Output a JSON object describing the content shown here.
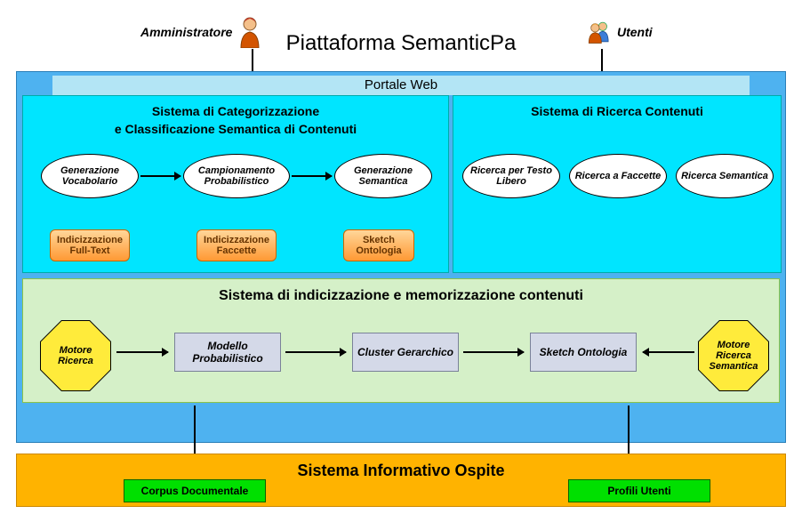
{
  "actors": {
    "admin": "Amministratore",
    "users": "Utenti"
  },
  "title": "Piattaforma SemanticPa",
  "portal": "Portale Web",
  "systemLeft": {
    "header1": "Sistema di Categorizzazione",
    "header2": "e Classificazione Semantica di Contenuti",
    "ellipses": {
      "e1": "Generazione Vocabolario",
      "e2": "Campionamento Probabilistico",
      "e3": "Generazione Semantica"
    },
    "boxes": {
      "b1": "Indicizzazione Full-Text",
      "b2": "Indicizzazione Faccette",
      "b3": "Sketch Ontologia"
    }
  },
  "systemRight": {
    "header": "Sistema di Ricerca Contenuti",
    "ellipses": {
      "e1": "Ricerca per Testo Libero",
      "e2": "Ricerca a Faccette",
      "e3": "Ricerca Semantica"
    }
  },
  "indexSystem": {
    "header": "Sistema di indicizzazione e memorizzazione contenuti",
    "oct1": "Motore Ricerca",
    "box1": "Modello Probabilistico",
    "box2": "Cluster Gerarchico",
    "box3": "Sketch Ontologia",
    "oct2": "Motore Ricerca Semantica"
  },
  "host": {
    "title": "Sistema Informativo Ospite",
    "box1": "Corpus Documentale",
    "box2": "Profili Utenti"
  }
}
